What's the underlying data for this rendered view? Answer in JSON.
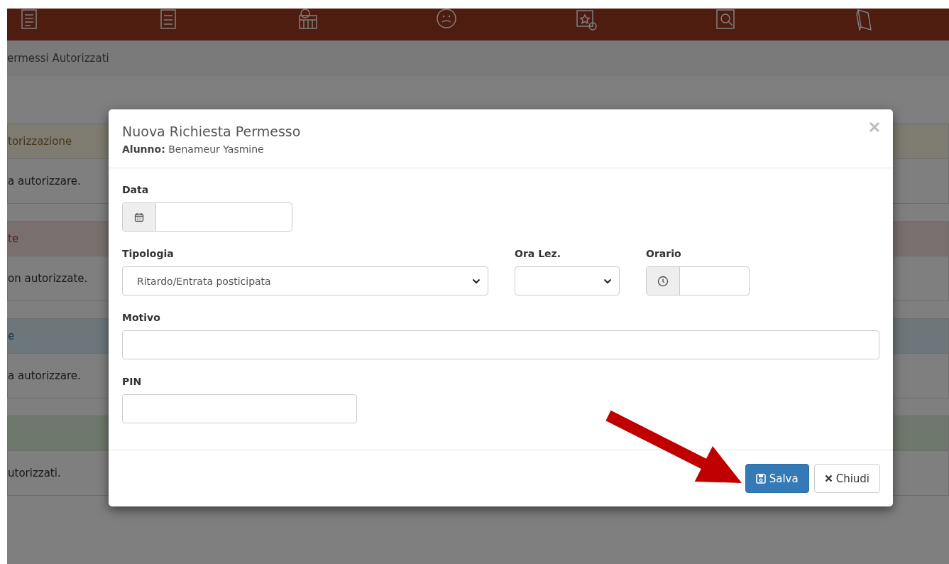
{
  "breadcrumb": "ermessi Autorizzati",
  "panels": [
    {
      "kind": "warning",
      "title": "torizzazione",
      "text": "a autorizzare."
    },
    {
      "kind": "danger",
      "title": "te",
      "text": "on autorizzate."
    },
    {
      "kind": "info",
      "title": "e",
      "text": "a autorizzare."
    },
    {
      "kind": "success",
      "text": "utorizzati."
    }
  ],
  "modal": {
    "title": "Nuova Richiesta Permesso",
    "subtitle": "**Alunno:** Benameur Yasmine",
    "rows": [
      [
        {
          "label": "Data",
          "kind": "date"
        }
      ],
      [
        {
          "label": "Tipologia",
          "kind": "select",
          "value": "Ritardo/Entrata posticipata"
        },
        {
          "label": "Ora Lez.",
          "kind": "select"
        },
        {
          "label": "Orario",
          "kind": "time"
        }
      ],
      [
        {
          "label": "Motivo",
          "kind": "text"
        }
      ],
      [
        {
          "label": "PIN",
          "kind": "text"
        }
      ]
    ],
    "buttons": [
      {
        "label": "Salva",
        "kind": "primary"
      },
      {
        "label": "Chiudi",
        "kind": "default"
      }
    ]
  }
}
